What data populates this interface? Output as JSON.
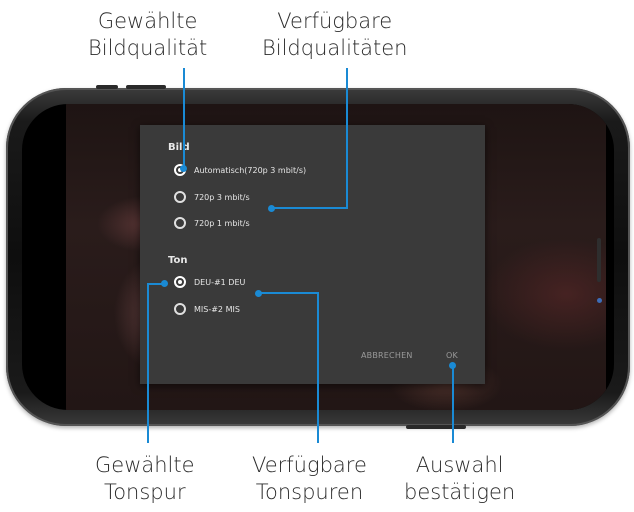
{
  "callouts": {
    "selected_quality": [
      "Gewählte",
      "Bildqualität"
    ],
    "available_qualities": [
      "Verfügbare",
      "Bildqualitäten"
    ],
    "selected_track": [
      "Gewählte",
      "Tonspur"
    ],
    "available_tracks": [
      "Verfügbare",
      "Tonspuren"
    ],
    "confirm": [
      "Auswahl",
      "bestätigen"
    ]
  },
  "dialog": {
    "picture_title": "Bild",
    "picture_options": [
      {
        "label": "Automatisch(720p 3 mbit/s)",
        "checked": true
      },
      {
        "label": "720p 3 mbit/s",
        "checked": false
      },
      {
        "label": "720p 1 mbit/s",
        "checked": false
      }
    ],
    "sound_title": "Ton",
    "sound_options": [
      {
        "label": "DEU-#1 DEU",
        "checked": true
      },
      {
        "label": "MIS-#2 MIS",
        "checked": false
      }
    ],
    "cancel_label": "ABBRECHEN",
    "ok_label": "OK"
  },
  "colors": {
    "accent": "#1a8ad4",
    "dialog_bg": "#3a3a3a"
  }
}
